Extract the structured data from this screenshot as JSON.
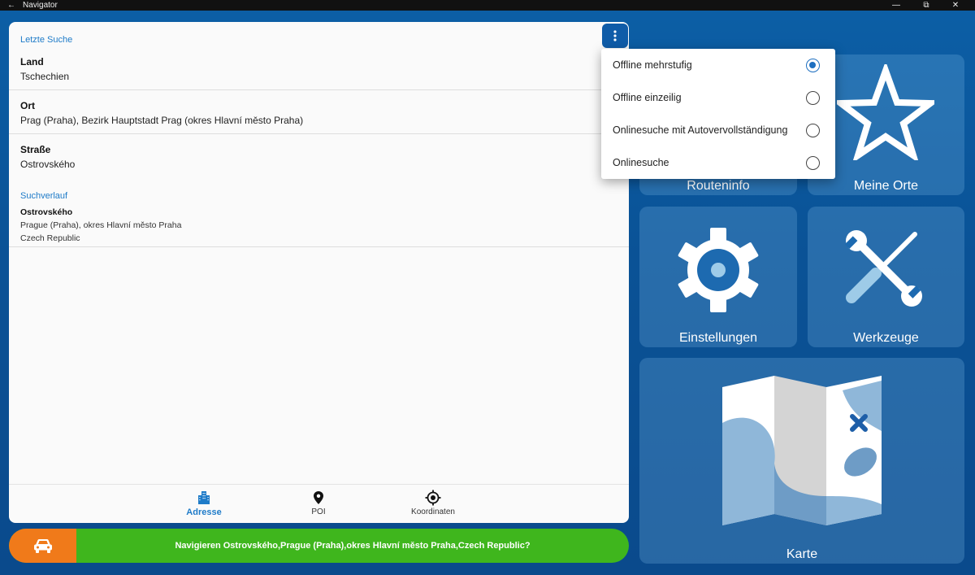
{
  "window": {
    "title": "Navigator",
    "back_glyph": "←",
    "minimize_glyph": "—",
    "restore_glyph": "⧉",
    "close_glyph": "✕"
  },
  "search": {
    "recent_title": "Letzte Suche",
    "fields": [
      {
        "label": "Land",
        "value": "Tschechien"
      },
      {
        "label": "Ort",
        "value": "Prag (Praha), Bezirk Hauptstadt Prag (okres Hlavní město Praha)"
      },
      {
        "label": "Straße",
        "value": "Ostrovského"
      }
    ],
    "history_title": "Suchverlauf",
    "history": [
      {
        "name": "Ostrovského",
        "line1": "Prague (Praha), okres Hlavní město Praha",
        "line2": "Czech Republic"
      }
    ]
  },
  "tabs": [
    {
      "label": "Adresse",
      "icon": "building-icon",
      "active": true
    },
    {
      "label": "POI",
      "icon": "map-pin-icon",
      "active": false
    },
    {
      "label": "Koordinaten",
      "icon": "crosshair-icon",
      "active": false
    }
  ],
  "navigate": {
    "text": "Navigieren Ostrovského,Prague (Praha),okres Hlavní město Praha,Czech Republic?",
    "icon": "car-icon"
  },
  "menu": {
    "options": [
      {
        "label": "Offline mehrstufig",
        "selected": true
      },
      {
        "label": "Offline einzeilig",
        "selected": false
      },
      {
        "label": "Onlinesuche mit Autovervollständigung",
        "selected": false
      },
      {
        "label": "Onlinesuche",
        "selected": false
      }
    ]
  },
  "tiles": {
    "routeinfo": "Routeninfo",
    "meine_orte": "Meine Orte",
    "einstellungen": "Einstellungen",
    "werkzeuge": "Werkzeuge",
    "karte": "Karte"
  },
  "colors": {
    "accent": "#1e7bc8",
    "navigate_green": "#3fb61d",
    "car_orange": "#f07a1a"
  }
}
